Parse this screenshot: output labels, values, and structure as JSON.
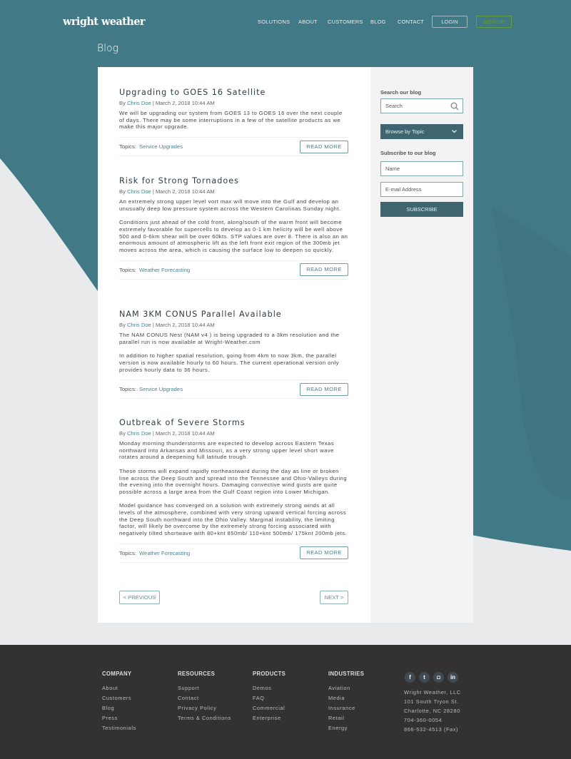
{
  "colors": {
    "teal": "#427986",
    "dark_teal": "#3f6670",
    "footer": "#333132",
    "link": "#4a8593",
    "signup": "#6a9e3a"
  },
  "header": {
    "logo": "wright weather",
    "nav": [
      "SOLUTIONS",
      "ABOUT",
      "CUSTOMERS",
      "BLOG",
      "CONTACT"
    ],
    "login": "LOGIN",
    "signup": "SIGN UP"
  },
  "page_title": "Blog",
  "posts": [
    {
      "title": "Upgrading to GOES 16 Satellite",
      "by": "By",
      "author": "Chris Doe",
      "date": "| March 2, 2018 10:44 AM",
      "body": [
        "We will be upgrading our system from GOES 13 to GOES 16 over the next couple of days.  There may be some  interruptions in a few of the satellite products as we make this major upgrade."
      ],
      "topics_label": "Topics:",
      "topic": "Service Upgrades",
      "read_more": "READ MORE"
    },
    {
      "title": "Risk for Strong Tornadoes",
      "by": "By",
      "author": "Chris Doe",
      "date": "| March 2, 2018 10:44 AM",
      "body": [
        "An extremely strong  upper level vort max will move into the Gulf and develop an unusually deep low pressure system across the Western Carolinas Sunday night.",
        "Conditions just ahead of the cold front, along/south of the warm front will become extremely favorable for supercells to develop as 0-1 km helicity will be well above 500 and 0-6km shear will be over 60kts.  STP values are over 8.  There is also an an enormous amount of atmospheric lift as the left front exit region of the 300mb jet moves across the area, which is causing the surface low to deepen so quickly."
      ],
      "topics_label": "Topics:",
      "topic": "Weather Forecasting",
      "read_more": "READ MORE"
    },
    {
      "title": "NAM 3KM CONUS Parallel Available",
      "by": "By",
      "author": "Chris Doe",
      "date": "| March 2, 2018 10:44 AM",
      "body": [
        "The NAM CONUS Nest (NAM v4 ) is being upgraded to a 3km resolution and the parallel run is now available at Wright-Weather.com",
        "In addition to higher spatial resolution, going from 4km to now 3km, the parallel version is now available hourly to 60 hours. The current operational version only provides hourly data to 36 hours."
      ],
      "topics_label": "Topics:",
      "topic": "Service Upgrades",
      "read_more": "READ MORE"
    },
    {
      "title": "Outbreak of Severe Storms",
      "by": "By",
      "author": "Chris Doe",
      "date": "| March 2, 2018 10:44 AM",
      "body": [
        "Monday morning thunderstorms are expected to develop across Eastern Texas northward into Arkansas and Missouri, as a very strong upper level short wave rotates around a deepening full latitude trough.",
        "These storms will expand rapidly northeastward during the day as line or broken line across the Deep South and spread into the Tennessee and Ohio-Valleys during the evening into the overnight hours. Damaging convective wind gusts are quite possible across a large area from the Gulf Coast region into Lower Michigan.",
        "Model guidance has converged on a solution with extremely strong winds at all levels of the atmosphere,  combined with very strong upward vertical forcing across the Deep South northward into the Ohio Valley.  Marginal instability, the limiting factor, will likely be overcome by the extremely strong forcing associated with negatively tilted shortwave with  80+knt 850mb/ 110+knt 500mb/ 175knt 200mb  jets."
      ],
      "topics_label": "Topics:",
      "topic": "Weather Forecasting",
      "read_more": "READ MORE"
    }
  ],
  "pagination": {
    "previous": "< PREVIOUS",
    "next": "NEXT >"
  },
  "sidebar": {
    "search_label": "Search our blog",
    "search_placeholder": "Search",
    "browse": "Browse by Topic",
    "subscribe_label": "Subscribe to our blog",
    "name_placeholder": "Name",
    "email_placeholder": "E-mail Address",
    "subscribe": "SUBSCRIBE"
  },
  "footer": {
    "columns": [
      {
        "title": "COMPANY",
        "items": [
          "About",
          "Customers",
          "Blog",
          "Press",
          "Testimonials"
        ]
      },
      {
        "title": "RESOURCES",
        "items": [
          "Support",
          "Contact",
          "Privacy Policy",
          "Terms & Conditions"
        ]
      },
      {
        "title": "PRODUCTS",
        "items": [
          "Demos",
          "FAQ",
          "Commercial",
          "Enterprise"
        ]
      },
      {
        "title": "INDUSTRIES",
        "items": [
          "Aviation",
          "Media",
          "Insurance",
          "Retail",
          "Energy"
        ]
      }
    ],
    "social": [
      "facebook-icon",
      "twitter-icon",
      "instagram-icon",
      "linkedin-icon"
    ],
    "address": [
      "Wright Weather, LLC",
      "101 South Tryon St.",
      "Charlotte, NC 28280",
      "704-360-0054",
      "866-532-4513 (Fax)"
    ]
  }
}
